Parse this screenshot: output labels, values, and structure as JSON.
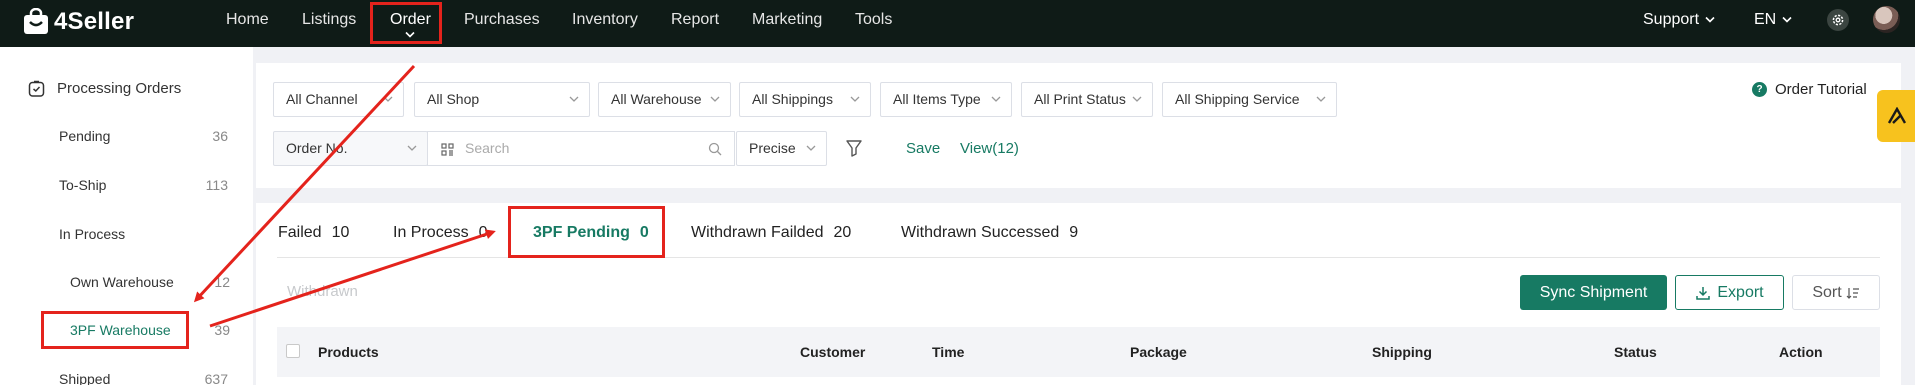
{
  "topbar": {
    "logo_text": "4Seller",
    "nav": [
      "Home",
      "Listings",
      "Order",
      "Purchases",
      "Inventory",
      "Report",
      "Marketing",
      "Tools"
    ],
    "active_nav": "Order",
    "support": "Support",
    "language": "EN"
  },
  "sidebar": {
    "section_title": "Processing Orders",
    "items": [
      {
        "label": "Pending",
        "count": "36"
      },
      {
        "label": "To-Ship",
        "count": "113"
      },
      {
        "label": "In Process",
        "count": ""
      },
      {
        "label": "Own Warehouse",
        "count": "12"
      },
      {
        "label": "3PF Warehouse",
        "count": "39"
      },
      {
        "label": "Shipped",
        "count": "637"
      }
    ]
  },
  "filters": {
    "row1": [
      "All Channel",
      "All Shop",
      "All Warehouse",
      "All Shippings",
      "All Items Type",
      "All Print Status",
      "All Shipping Service"
    ],
    "order_field": "Order No.",
    "search_placeholder": "Search",
    "match_mode": "Precise",
    "save": "Save",
    "view": "View(12)",
    "tutorial": "Order Tutorial"
  },
  "tabs": [
    {
      "label": "Failed",
      "count": "10"
    },
    {
      "label": "In Process",
      "count": "0"
    },
    {
      "label": "3PF Pending",
      "count": "0"
    },
    {
      "label": "Withdrawn Failded",
      "count": "20"
    },
    {
      "label": "Withdrawn Successed",
      "count": "9"
    }
  ],
  "active_tab": "3PF Pending",
  "toolbar": {
    "withdrawn": "Withdrawn",
    "sync": "Sync Shipment",
    "export": "Export",
    "sort": "Sort"
  },
  "table": {
    "columns": [
      "Products",
      "Customer",
      "Time",
      "Package",
      "Shipping",
      "Status",
      "Action"
    ]
  },
  "colors": {
    "topbar": "#0f1b17",
    "accent": "#177a63",
    "highlight": "#e4231c",
    "float_button": "#f7c21e"
  }
}
